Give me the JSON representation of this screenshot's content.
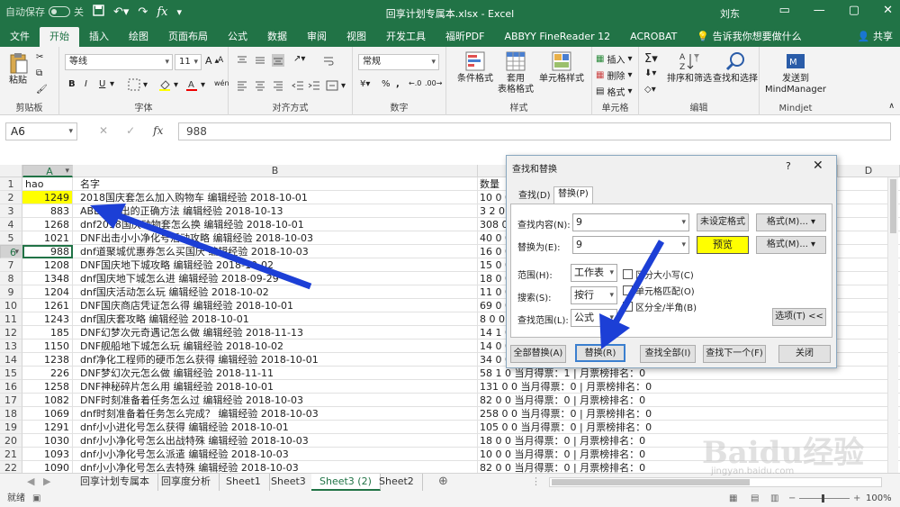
{
  "app": {
    "autosave_label": "自动保存",
    "autosave_state": "关",
    "title": "回享计划专属本.xlsx  -  Excel",
    "user": "刘东",
    "share": "共享",
    "tell_me": "告诉我你想要做什么"
  },
  "tabs": [
    "文件",
    "开始",
    "插入",
    "绘图",
    "页面布局",
    "公式",
    "数据",
    "审阅",
    "视图",
    "开发工具",
    "福昕PDF",
    "ABBYY FineReader 12",
    "ACROBAT"
  ],
  "ribbon": {
    "clipboard": {
      "label": "剪贴板",
      "paste": "粘贴"
    },
    "font": {
      "label": "字体",
      "name": "等线",
      "size": "11",
      "bold": "B",
      "italic": "I",
      "underline": "U",
      "grow": "A",
      "shrink": "A",
      "phonetic": "wén"
    },
    "alignment": {
      "label": "对齐方式"
    },
    "number": {
      "label": "数字",
      "format": "常规",
      "percent": "%",
      "comma": ","
    },
    "styles": {
      "label": "样式",
      "cond": "条件格式",
      "table": "套用\n表格格式",
      "cell": "单元格样式"
    },
    "cells": {
      "label": "单元格",
      "insert": "插入",
      "delete": "删除",
      "format": "格式"
    },
    "editing": {
      "label": "编辑",
      "sort": "排序和筛选",
      "find": "查找和选择"
    },
    "mindjet": {
      "label": "Mindjet",
      "send": "发送到\nMindManager"
    }
  },
  "formula_bar": {
    "name_box": "A6",
    "fx": "fx",
    "value": "988"
  },
  "columns": [
    "A",
    "B",
    "C",
    "D"
  ],
  "headers": {
    "a": "hao",
    "b": "名字",
    "c": "数量"
  },
  "rows": [
    {
      "n": "1",
      "a": "hao",
      "b": "名字",
      "c": "数量"
    },
    {
      "n": "2",
      "a": "1249",
      "b": "2018国庆套怎么加入购物车 编辑经验 2018-10-01",
      "c": "10 0 0 当月得票：0 | 月票榜排名：0"
    },
    {
      "n": "3",
      "a": "883",
      "b": "ABB小伙出的正确方法 编辑经验 2018-10-13",
      "c": "3 2 0 当月得票：0 | 月票榜排名：0"
    },
    {
      "n": "4",
      "a": "1268",
      "b": "dnf2018国庆动物套怎么换 编辑经验 2018-10-01",
      "c": "308 0 0 当月得票：0 | 月票榜排名：0"
    },
    {
      "n": "5",
      "a": "1021",
      "b": "DNF出击小小净化号活动攻略 编辑经验 2018-10-03",
      "c": "40 0 0 当月得票：0 | 月票榜排名：0"
    },
    {
      "n": "6",
      "a": "988",
      "b": "dnf道聚城优惠券怎么买国庆 编辑经验 2018-10-03",
      "c": "16 0 0 当月得票：0 | 月票榜排名：0"
    },
    {
      "n": "7",
      "a": "1208",
      "b": "DNF国庆地下城攻略 编辑经验 2018-10-02",
      "c": "15 0 0 当月得票：0 | 月票榜排名：0"
    },
    {
      "n": "8",
      "a": "1348",
      "b": "dnf国庆地下城怎么进 编辑经验 2018-09-29",
      "c": "18 0 0 当月得票：0 | 月票榜排名：0"
    },
    {
      "n": "9",
      "a": "1204",
      "b": "dnf国庆活动怎么玩 编辑经验 2018-10-02",
      "c": "11 0 0 当月得票：0 | 月票榜排名：0"
    },
    {
      "n": "10",
      "a": "1261",
      "b": "DNF国庆商店凭证怎么得 编辑经验 2018-10-01",
      "c": "69 0 0 当月得票：0 | 月票榜排名：0"
    },
    {
      "n": "11",
      "a": "1243",
      "b": "dnf国庆套攻略 编辑经验 2018-10-01",
      "c": "8 0 0 当月得票：0 | 月票榜排名：0"
    },
    {
      "n": "12",
      "a": "185",
      "b": "DNF幻梦次元奇遇记怎么做 编辑经验 2018-11-13",
      "c": "14 1 0 当月得票：0 | 月票榜排名：0"
    },
    {
      "n": "13",
      "a": "1150",
      "b": "DNF舰船地下城怎么玩 编辑经验 2018-10-02",
      "c": "14 0 0 当月得票：0 | 月票榜排名：0"
    },
    {
      "n": "14",
      "a": "1238",
      "b": "dnf净化工程师的硬币怎么获得 编辑经验 2018-10-01",
      "c": "34 0 0 当月得票：0 | 月票榜排名：0"
    },
    {
      "n": "15",
      "a": "226",
      "b": "DNF梦幻次元怎么做 编辑经验 2018-11-11",
      "c": "58 1 0 当月得票：1 | 月票榜排名：0"
    },
    {
      "n": "16",
      "a": "1258",
      "b": "DNF神秘碎片怎么用 编辑经验 2018-10-01",
      "c": "131 0 0 当月得票：0 | 月票榜排名：0"
    },
    {
      "n": "17",
      "a": "1082",
      "b": "DNF时刻准备着任务怎么过 编辑经验 2018-10-03",
      "c": "82 0 0 当月得票：0 | 月票榜排名：0"
    },
    {
      "n": "18",
      "a": "1069",
      "b": "dnf时刻准备着任务怎么完成？ 编辑经验 2018-10-03",
      "c": "258 0 0 当月得票：0 | 月票榜排名：0"
    },
    {
      "n": "19",
      "a": "1291",
      "b": "dnf小小进化号怎么获得 编辑经验 2018-10-01",
      "c": "105 0 0 当月得票：0 | 月票榜排名：0"
    },
    {
      "n": "20",
      "a": "1030",
      "b": "dnf小小净化号怎么出战特殊 编辑经验 2018-10-03",
      "c": "18 0 0 当月得票：0 | 月票榜排名：0"
    },
    {
      "n": "21",
      "a": "1093",
      "b": "dnf小小净化号怎么派遣 编辑经验 2018-10-03",
      "c": "10 0 0 当月得票：0 | 月票榜排名：0"
    },
    {
      "n": "22",
      "a": "1090",
      "b": "dnf小小净化号怎么去特殊 编辑经验 2018-10-03",
      "c": "82 0 0 当月得票：0 | 月票榜排名：0"
    }
  ],
  "sheets": [
    "回享计划专属本",
    "回享度分析",
    "Sheet1",
    "Sheet3",
    "Sheet3 (2)",
    "Sheet2"
  ],
  "status": {
    "ready": "就绪",
    "zoom": "100%"
  },
  "dialog": {
    "title": "查找和替换",
    "help": "?",
    "close": "✕",
    "tab_find": "查找(D)",
    "tab_replace": "替换(P)",
    "find_label": "查找内容(N):",
    "find_value": "9",
    "find_format_status": "未设定格式",
    "format_btn": "格式(M)...",
    "replace_label": "替换为(E):",
    "replace_value": "9",
    "preview": "预览",
    "format_btn2": "格式(M)...",
    "scope_label": "范围(H):",
    "scope_value": "工作表",
    "search_label": "搜索(S):",
    "search_value": "按行",
    "lookin_label": "查找范围(L):",
    "lookin_value": "公式",
    "case": "区分大小写(C)",
    "whole": "单元格匹配(O)",
    "width": "区分全/半角(B)",
    "options_btn": "选项(T) <<",
    "replace_all": "全部替换(A)",
    "replace": "替换(R)",
    "find_all": "查找全部(I)",
    "find_next": "查找下一个(F)",
    "close_btn": "关闭"
  },
  "watermark": {
    "brand": "Baidu经验",
    "url": "jingyan.baidu.com"
  }
}
